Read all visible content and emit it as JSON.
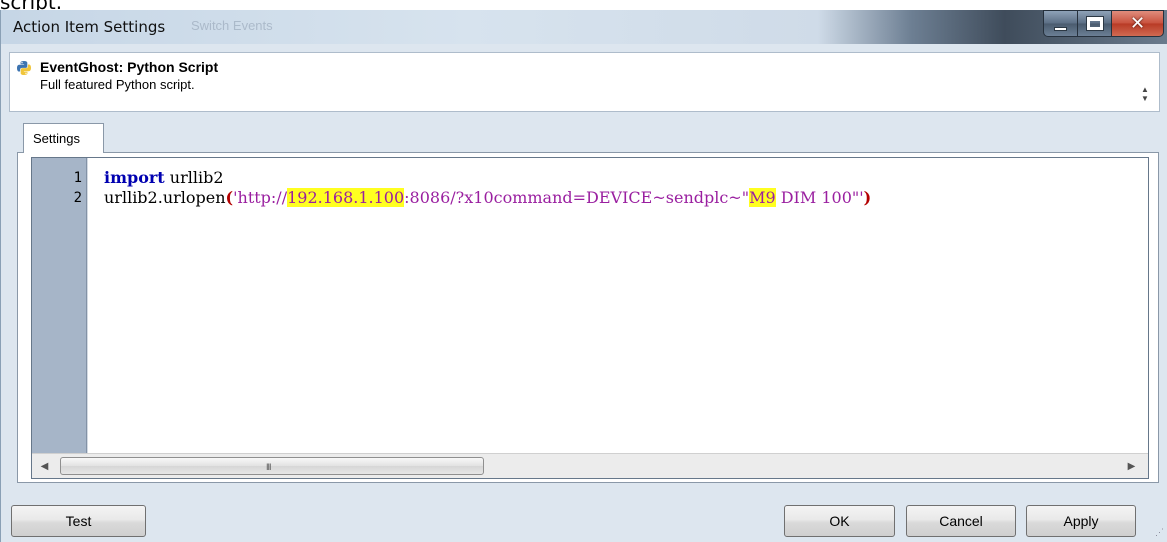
{
  "page_fragment": "script.",
  "window": {
    "title": "Action Item Settings",
    "background_title": "Switch Events"
  },
  "header": {
    "plugin_title": "EventGhost: Python Script",
    "plugin_description": "Full featured Python script."
  },
  "tabs": [
    {
      "label": "Settings",
      "active": true
    }
  ],
  "editor": {
    "line_numbers": [
      "1",
      "2"
    ],
    "lines": [
      {
        "keyword": "import",
        "rest": " urllib2"
      },
      {
        "call": "urllib2.urlopen",
        "open_paren": "(",
        "str_start": "'http://",
        "ip_highlight": "192.168.1.100",
        "str_mid": ":8086/?x10command=DEVICE~sendplc~\"",
        "device_highlight": "M9",
        "str_end": " DIM 100\"'",
        "close_paren": ")"
      }
    ],
    "scroll_grip": "III",
    "highlight_color": "#ffff20"
  },
  "buttons": {
    "test": "Test",
    "ok": "OK",
    "cancel": "Cancel",
    "apply": "Apply"
  }
}
